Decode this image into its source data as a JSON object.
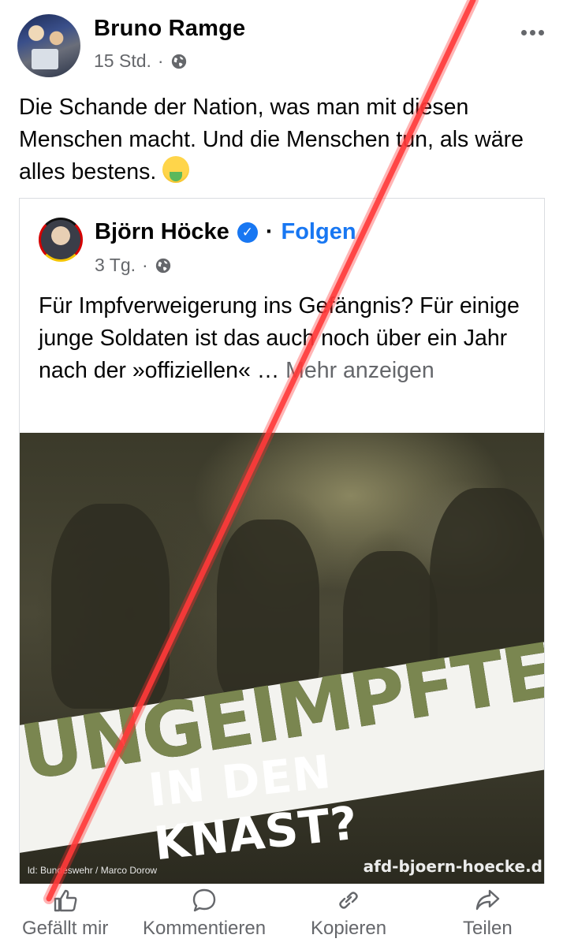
{
  "post": {
    "author": "Bruno Ramge",
    "time": "15 Std.",
    "privacy_icon": "globe-icon",
    "text": "Die Schande der Nation, was man mit diesen Menschen macht. Und die Menschen tun, als wäre alles bestens.",
    "emoji": "nauseated-face-emoji"
  },
  "shared": {
    "author": "Björn Höcke",
    "separator": "·",
    "follow_label": "Folgen",
    "time": "3 Tg.",
    "text": "Für Impfverweigerung ins Gefängnis? Für einige junge Soldaten ist das auch noch über ein Jahr nach der »offiziellen« …",
    "more_label": "Mehr anzeigen",
    "image": {
      "headline": "UNGEIMPFTE",
      "subline": "IN DEN KNAST?",
      "credit": "ld: Bundeswehr / Marco Dorow",
      "watermark": "afd-bjoern-hoecke.d"
    }
  },
  "actions": [
    {
      "label": "Gefällt mir",
      "icon": "thumbs-up-icon"
    },
    {
      "label": "Kommentieren",
      "icon": "comment-icon"
    },
    {
      "label": "Kopieren",
      "icon": "link-icon"
    },
    {
      "label": "Teilen",
      "icon": "share-icon"
    }
  ],
  "colors": {
    "link_blue": "#1877f2",
    "secondary_text": "#65676b",
    "strike_red": "#ff2a2a"
  }
}
